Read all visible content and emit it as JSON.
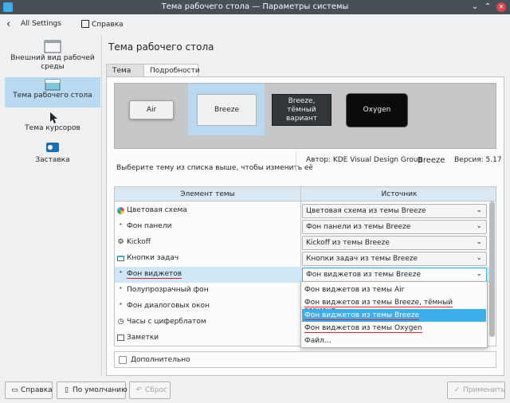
{
  "window": {
    "title": "Тема рабочего стола — Параметры системы",
    "minimize_glyph": "⌄",
    "maximize_glyph": "⌃",
    "close_glyph": "✕"
  },
  "toolbar": {
    "back_glyph": "‹",
    "all_settings": "All Settings",
    "help": "Справка"
  },
  "sidebar": {
    "items": [
      {
        "label": "Внешний вид рабочей среды",
        "icon": "appearance-icon"
      },
      {
        "label": "Тема рабочего стола",
        "icon": "desktop-theme-icon"
      },
      {
        "label": "Тема курсоров",
        "icon": "cursor-icon"
      },
      {
        "label": "Заставка",
        "icon": "splash-toggle-icon"
      }
    ]
  },
  "main": {
    "title": "Тема рабочего стола",
    "tabs": [
      {
        "label": "Тема"
      },
      {
        "label": "Подробности"
      }
    ]
  },
  "themes": [
    {
      "label": "Air"
    },
    {
      "label": "Breeze"
    },
    {
      "label": "Breeze, тёмный вариант"
    },
    {
      "label": "Oxygen"
    }
  ],
  "info": {
    "hint": "Выберите тему из списка выше, чтобы изменить её",
    "author": "Автор: KDE Visual Design Group",
    "name": "Breeze",
    "version": "Версия: 5.17"
  },
  "table": {
    "headers": [
      "Элемент темы",
      "Источник"
    ],
    "rows": [
      {
        "label": "Цветовая схема",
        "source": "Цветовая схема из темы Breeze"
      },
      {
        "label": "Фон панели",
        "source": "Фон панели из темы Breeze"
      },
      {
        "label": "Kickoff",
        "source": "Kickoff из темы Breeze"
      },
      {
        "label": "Кнопки задач",
        "source": "Кнопки задач из темы Breeze"
      },
      {
        "label": "Фон виджетов",
        "source": "Фон виджетов из темы Breeze"
      },
      {
        "label": "Полупрозрачный фон",
        "source": ""
      },
      {
        "label": "Фон диалоговых окон",
        "source": ""
      },
      {
        "label": "Часы с циферблатом",
        "source": ""
      },
      {
        "label": "Заметки",
        "source": ""
      }
    ]
  },
  "dropdown": {
    "options": [
      "Фон виджетов из темы Air",
      "Фон виджетов из темы Breeze, тёмный вариант",
      "Фон виджетов из темы Breeze",
      "Фон виджетов из темы Oxygen",
      "Файл..."
    ]
  },
  "advanced": {
    "label": "Дополнительно"
  },
  "buttons": {
    "help": "Справка",
    "defaults": "По умолчанию",
    "reset": "Сброс",
    "apply": "Применить"
  },
  "colors": {
    "accent": "#3daee9",
    "selection": "#b8d9f0",
    "annotation_underline": "#e0202a"
  }
}
